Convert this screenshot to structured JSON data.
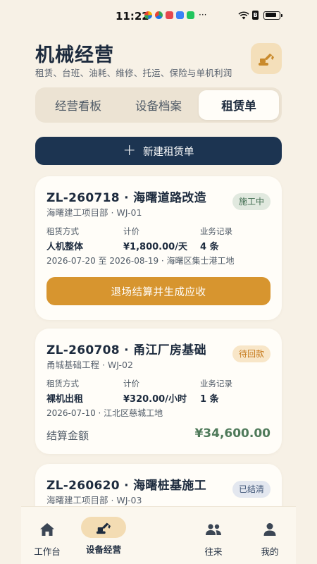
{
  "status_bar": {
    "time": "11:22",
    "more": "···",
    "sim_label": "B",
    "battery_level": 0.85
  },
  "header": {
    "title": "机械经营",
    "subtitle": "租赁、台班、油耗、维修、托运、保险与单机利润",
    "action_icon": "excavator-icon"
  },
  "tabs": [
    {
      "label": "经营看板",
      "active": false
    },
    {
      "label": "设备档案",
      "active": false
    },
    {
      "label": "租赁单",
      "active": true
    }
  ],
  "new_button": {
    "icon": "plus-icon",
    "label": "新建租赁单"
  },
  "orders": [
    {
      "title": "ZL-260718 · 海曙道路改造",
      "subtitle": "海曙建工项目部 · WJ-01",
      "status": "施工中",
      "status_color": "#3e6b4e",
      "meta": [
        {
          "label": "租赁方式",
          "value": "人机整体"
        },
        {
          "label": "计价",
          "value": "¥1,800.00/天"
        },
        {
          "label": "业务记录",
          "value": "4 条"
        }
      ],
      "period": "2026-07-20 至 2026-08-19 · 海曙区集士港工地",
      "action_label": "退场结算并生成应收"
    },
    {
      "title": "ZL-260708 · 甬江厂房基础",
      "subtitle": "甬城基础工程 · WJ-02",
      "status": "待回款",
      "status_color": "#c67a1c",
      "meta": [
        {
          "label": "租赁方式",
          "value": "裸机出租"
        },
        {
          "label": "计价",
          "value": "¥320.00/小时"
        },
        {
          "label": "业务记录",
          "value": "1 条"
        }
      ],
      "period": "2026-07-10 · 江北区慈城工地",
      "amount_label": "结算金额",
      "amount_value": "¥34,600.00"
    },
    {
      "title": "ZL-260620 · 海曙桩基施工",
      "subtitle": "海曙建工项目部 · WJ-03",
      "status": "已结清",
      "status_color": "#405677"
    }
  ],
  "bottom_nav": [
    {
      "label": "工作台",
      "icon": "home-icon",
      "active": false
    },
    {
      "label": "设备经营",
      "icon": "excavator-icon",
      "active": true
    },
    {
      "label": "往来",
      "icon": "people-icon",
      "active": false
    },
    {
      "label": "我的",
      "icon": "person-icon",
      "active": false
    }
  ],
  "colors": {
    "background": "#f7f1e6",
    "primary_dark": "#1c3451",
    "accent_orange": "#d7952f",
    "amount_green": "#4f7a5a"
  }
}
